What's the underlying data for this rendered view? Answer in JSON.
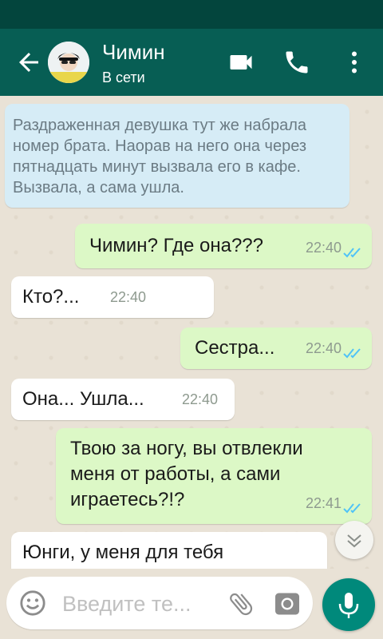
{
  "header": {
    "contact_name": "Чимин",
    "contact_status": "В сети",
    "background_color": "#075e54",
    "icons": [
      "back-arrow-icon",
      "video-call-icon",
      "phone-icon",
      "more-vert-icon"
    ]
  },
  "chat": {
    "system_message": "Раздраженная девушка тут же набрала номер брата. Наорав на него она через пятнадцать минут вызвала его в кафе. Вызвала, а сама ушла.",
    "messages": [
      {
        "direction": "out",
        "text": "Чимин? Где она???",
        "time": "22:40",
        "read": true
      },
      {
        "direction": "in",
        "text": "Кто?...",
        "time": "22:40"
      },
      {
        "direction": "out",
        "text": "Сестра...",
        "time": "22:40",
        "read": true
      },
      {
        "direction": "in",
        "text": "Она... Ушла...",
        "time": "22:40"
      },
      {
        "direction": "out",
        "text": "Твою за ногу, вы отвлекли меня от работы, а сами играетесь?!?",
        "time": "22:41",
        "read": true
      },
      {
        "direction": "in",
        "text": "Юнги, у меня для тебя",
        "time": ""
      }
    ]
  },
  "composer": {
    "placeholder": "Введите те...",
    "icons": [
      "emoji-icon",
      "attach-icon",
      "camera-icon",
      "mic-icon"
    ],
    "accent_color": "#00897b"
  },
  "colors": {
    "outgoing_bubble": "#dcf8c6",
    "incoming_bubble": "#ffffff",
    "system_bubble": "#d6ecf6",
    "read_ticks": "#4fc3f7"
  }
}
